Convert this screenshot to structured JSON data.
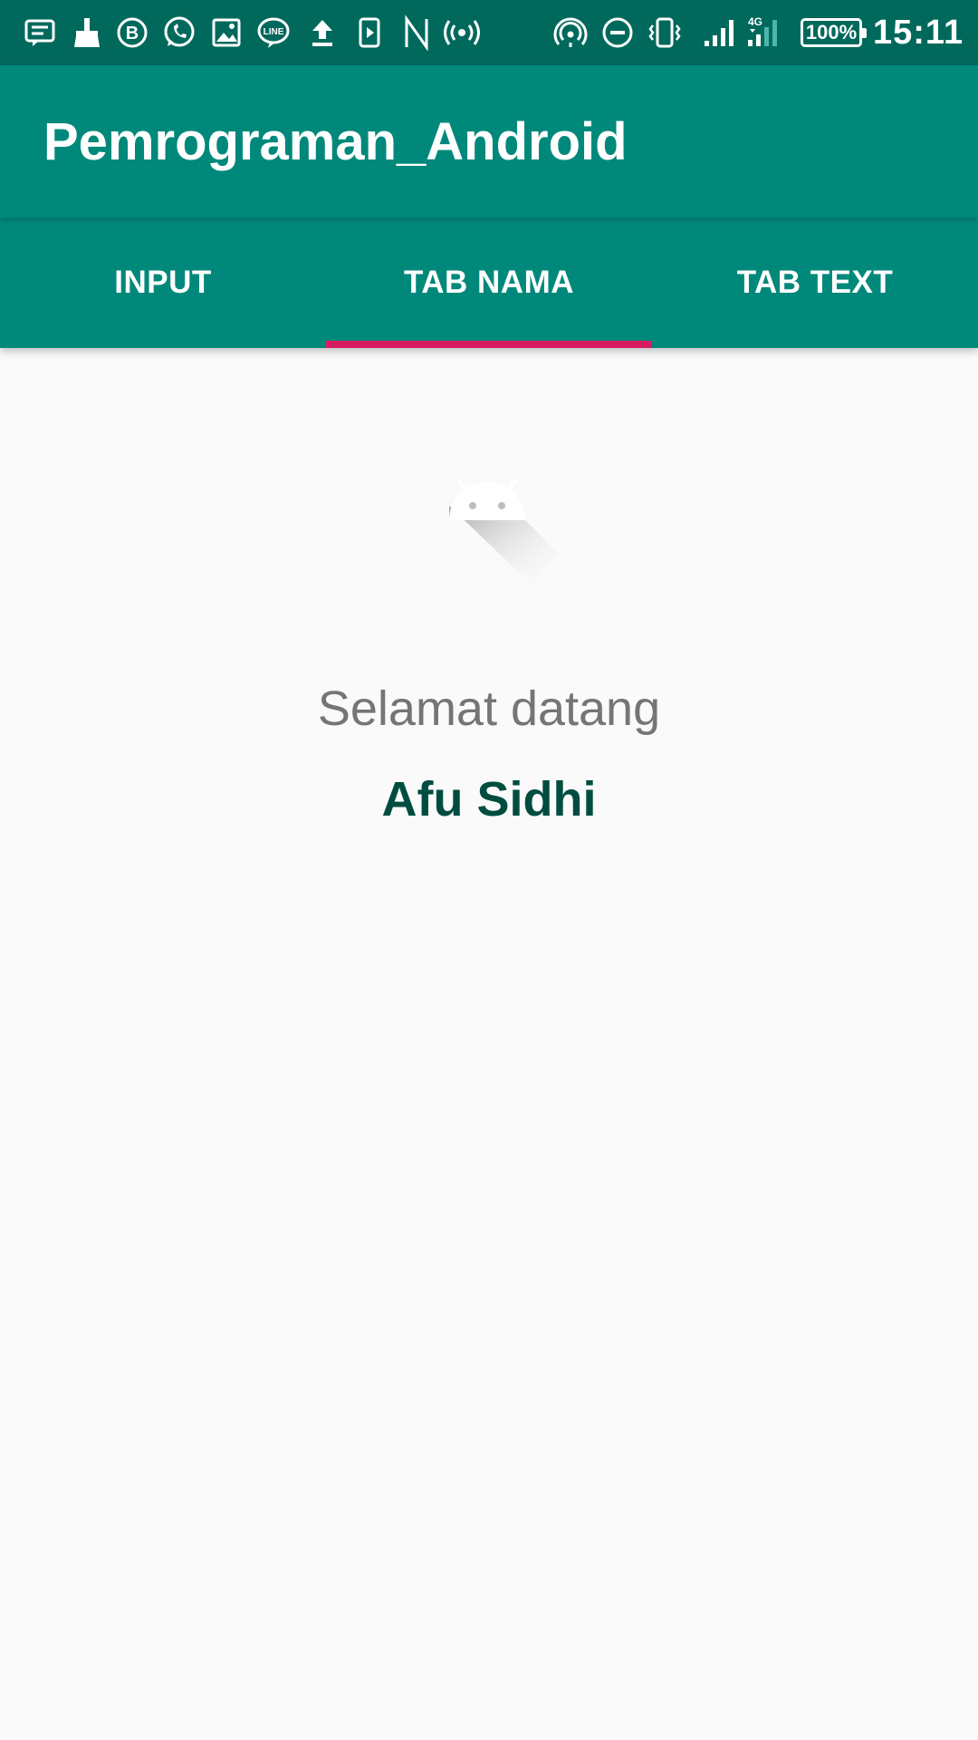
{
  "status_bar": {
    "left_icons": [
      "message-icon",
      "cleaner-icon",
      "whatsapp-business-icon",
      "whatsapp-icon",
      "gallery-icon",
      "line-icon",
      "upload-icon",
      "video-icon",
      "n-icon",
      "hotspot-icon"
    ],
    "right_icons": [
      "wireless-icon",
      "do-not-disturb-icon",
      "vibrate-icon",
      "signal-icon",
      "signal-4g-icon"
    ],
    "battery": "100%",
    "time": "15:11"
  },
  "app_bar": {
    "title": "Pemrograman_Android",
    "color": "#00897b"
  },
  "tabs": [
    {
      "label": "INPUT",
      "selected": false
    },
    {
      "label": "TAB NAMA",
      "selected": true
    },
    {
      "label": "TAB TEXT",
      "selected": false
    }
  ],
  "tab_indicator_color": "#d81b60",
  "content": {
    "logo_icon": "android-icon",
    "greeting": "Selamat datang",
    "name": "Afu Sidhi"
  }
}
